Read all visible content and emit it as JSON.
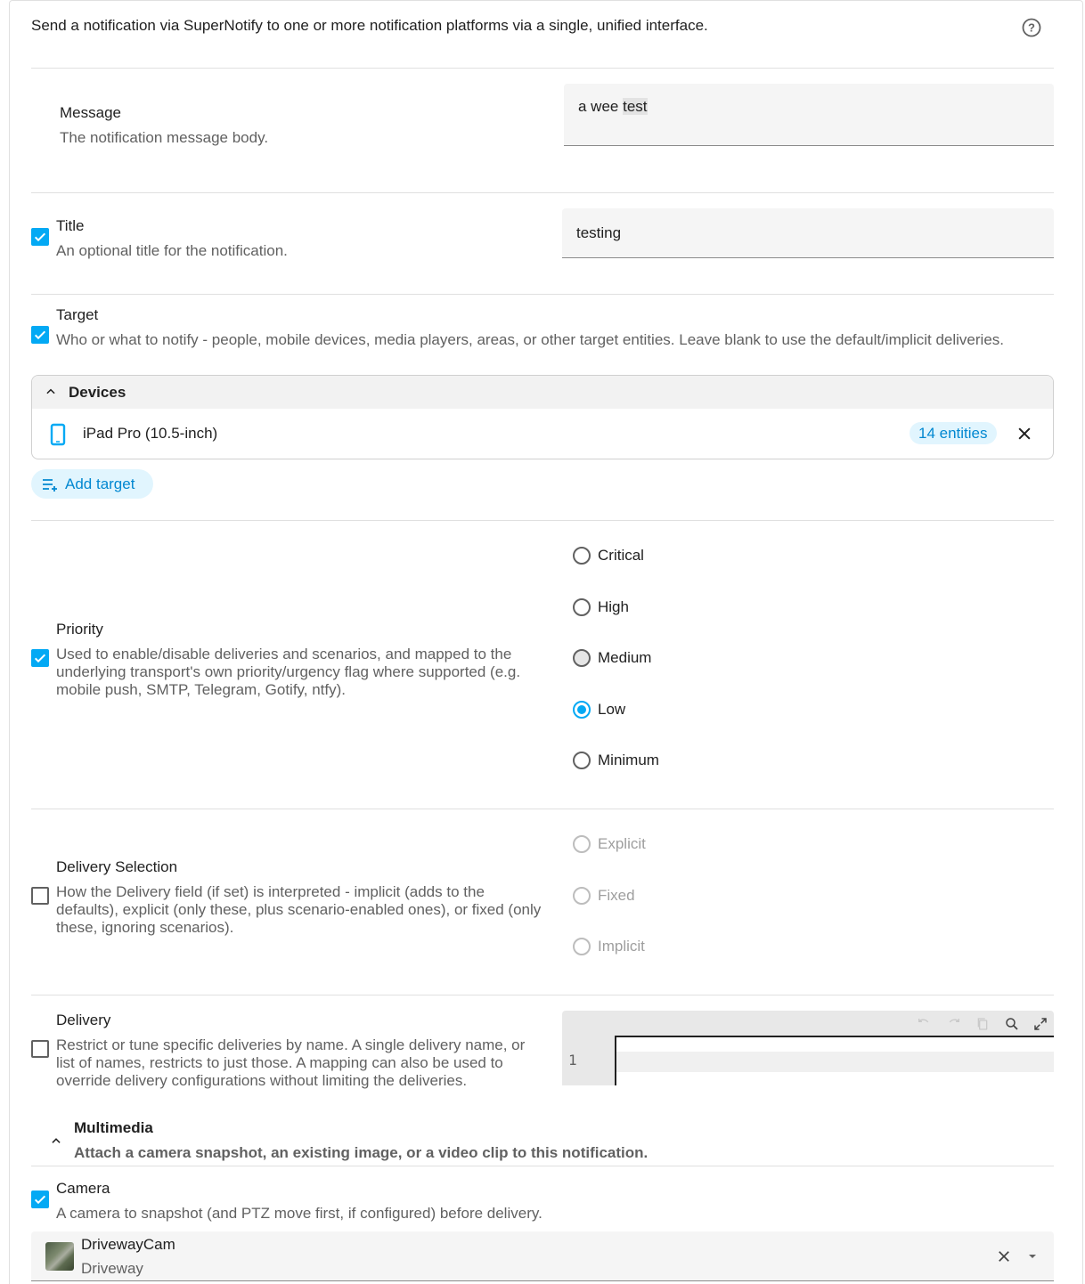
{
  "intro": {
    "text": "Send a notification via SuperNotify to one or more notification platforms via a single, unified interface.",
    "help_icon": "help-circle-icon"
  },
  "message": {
    "label": "Message",
    "description": "The notification message body.",
    "value_plain": "a wee ",
    "value_highlight": "test"
  },
  "title": {
    "label": "Title",
    "description": "An optional title for the notification.",
    "value": "testing",
    "checked": true
  },
  "target": {
    "label": "Target",
    "description": "Who or what to notify - people, mobile devices, media players, areas, or other target entities. Leave blank to use the default/implicit deliveries.",
    "checked": true,
    "group_title": "Devices",
    "device_name": "iPad Pro (10.5-inch)",
    "device_badge": "14 entities",
    "add_label": "Add target"
  },
  "priority": {
    "label": "Priority",
    "description": "Used to enable/disable deliveries and scenarios, and mapped to the underlying transport's own priority/urgency flag where supported (e.g. mobile push, SMTP, Telegram, Gotify, ntfy).",
    "checked": true,
    "options": [
      "Critical",
      "High",
      "Medium",
      "Low",
      "Minimum"
    ],
    "selected": "Low"
  },
  "delivery_selection": {
    "label": "Delivery Selection",
    "description": "How the Delivery field (if set) is interpreted - implicit (adds to the defaults), explicit (only these, plus scenario-enabled ones), or fixed (only these, ignoring scenarios).",
    "checked": false,
    "options": [
      "Explicit",
      "Fixed",
      "Implicit"
    ]
  },
  "delivery": {
    "label": "Delivery",
    "description": "Restrict or tune specific deliveries by name. A single delivery name, or list of names, restricts to just those. A mapping can also be used to override delivery configurations without limiting the deliveries.",
    "checked": false,
    "line_number": "1"
  },
  "multimedia": {
    "title": "Multimedia",
    "description": "Attach a camera snapshot, an existing image, or a video clip to this notification."
  },
  "camera": {
    "label": "Camera",
    "description": "A camera to snapshot (and PTZ move first, if configured) before delivery.",
    "checked": true,
    "entity_name": "DrivewayCam",
    "entity_area": "Driveway"
  },
  "colors": {
    "accent": "#03a9f4",
    "badge_bg": "#e1f5fe"
  }
}
